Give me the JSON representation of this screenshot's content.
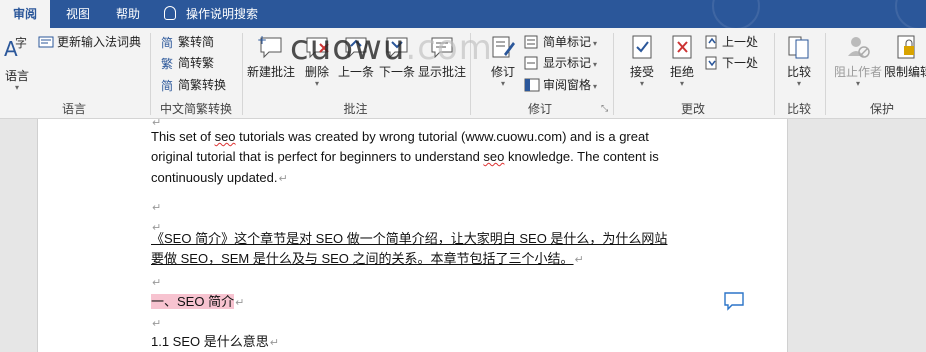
{
  "tabs": [
    {
      "label": "审阅",
      "active": true
    },
    {
      "label": "视图",
      "active": false
    },
    {
      "label": "帮助",
      "active": false
    }
  ],
  "tell_me": "操作说明搜索",
  "ribbon": {
    "language": {
      "lang_button": "语言",
      "ime_update": "更新输入法词典",
      "group_label": "语言"
    },
    "chinese": {
      "to_simplified": "繁转简",
      "to_traditional": "简转繁",
      "convert": "简繁转换",
      "group_label": "中文简繁转换"
    },
    "comments": {
      "new": "新建批注",
      "delete": "删除",
      "prev": "上一条",
      "next": "下一条",
      "show": "显示批注",
      "group_label": "批注"
    },
    "tracking": {
      "track": "修订",
      "markup_select": "简单标记",
      "show_markup": "显示标记",
      "reviewing_pane": "审阅窗格",
      "group_label": "修订"
    },
    "changes": {
      "accept": "接受",
      "reject": "拒绝",
      "prev": "上一处",
      "next": "下一处",
      "group_label": "更改"
    },
    "compare": {
      "compare": "比较",
      "group_label": "比较"
    },
    "protect": {
      "block_authors": "阻止作者",
      "restrict": "限制编辑",
      "group_label": "保护"
    }
  },
  "watermark": {
    "main": "cuowu",
    "dim": ".com"
  },
  "document": {
    "lines": [
      {
        "parts": [
          {
            "t": "This set of "
          },
          {
            "t": "seo",
            "squig": true
          },
          {
            "t": " tutorials was created by wrong tutorial (www.cuowu.com) and is a great"
          }
        ]
      },
      {
        "parts": [
          {
            "t": "original tutorial that is perfect for beginners to understand "
          },
          {
            "t": "seo",
            "squig": true
          },
          {
            "t": " knowledge. The content is"
          }
        ]
      },
      {
        "parts": [
          {
            "t": "continuously updated."
          }
        ]
      }
    ],
    "para_cn_1": "《SEO 简介》这个章节是对 SEO 做一个简单介绍，让大家明白 SEO 是什么，为什么网站",
    "para_cn_2": "要做 SEO，SEM 是什么及与 SEO 之间的关系。本章节包括了三个小结。",
    "heading": "一、SEO 简介",
    "subheading": "1.1 SEO 是什么意思",
    "para_mark": "↵",
    "colors": {
      "brand": "#2b579a",
      "highlight": "#f7c3d0",
      "spell": "#d33",
      "comment": "#2b74c8"
    }
  }
}
